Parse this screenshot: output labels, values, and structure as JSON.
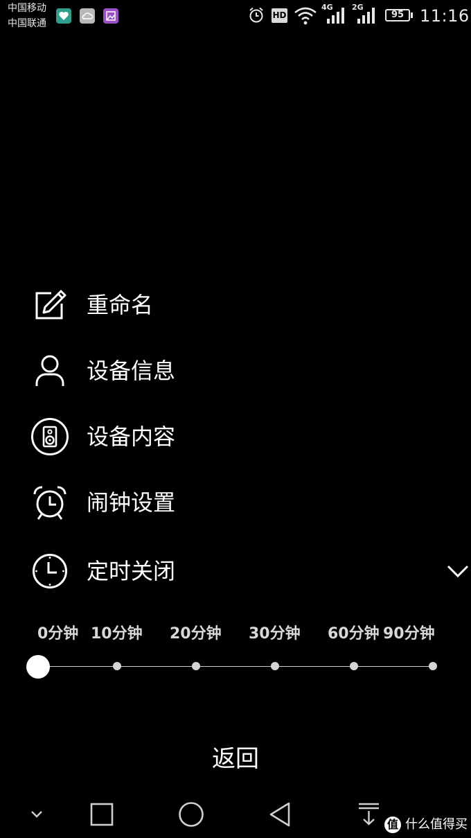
{
  "status_bar": {
    "carrier_1": "中国移动",
    "carrier_2": "中国联通",
    "hd_label": "HD",
    "network_1": "4G",
    "network_2": "2G",
    "battery": "95",
    "time": "11:16",
    "icons": [
      "health-app-icon",
      "cloud-app-icon",
      "gallery-app-icon",
      "alarm-icon",
      "hd-icon",
      "wifi-icon",
      "signal-4g-icon",
      "signal-2g-icon",
      "battery-icon"
    ]
  },
  "menu": {
    "items": [
      {
        "label": "重命名",
        "icon": "edit-icon"
      },
      {
        "label": "设备信息",
        "icon": "person-icon"
      },
      {
        "label": "设备内容",
        "icon": "speaker-icon"
      },
      {
        "label": "闹钟设置",
        "icon": "alarm-clock-icon"
      },
      {
        "label": "定时关闭",
        "icon": "clock-icon"
      }
    ],
    "expand_icon": "chevron-down-icon"
  },
  "timer": {
    "options": [
      "0分钟",
      "10分钟",
      "20分钟",
      "30分钟",
      "60分钟",
      "90分钟"
    ],
    "selected_index": 0
  },
  "back_label": "返回",
  "nav_bar": {
    "icons": [
      "hide-nav-icon",
      "recents-icon",
      "home-icon",
      "back-icon",
      "pull-down-notifications-icon"
    ]
  },
  "watermark": {
    "badge": "值",
    "text": "什么值得买"
  },
  "colors": {
    "background": "#000000",
    "text": "#ffffff",
    "tick_label": "#d8d8d8",
    "slider_track": "#cfcfcf"
  }
}
